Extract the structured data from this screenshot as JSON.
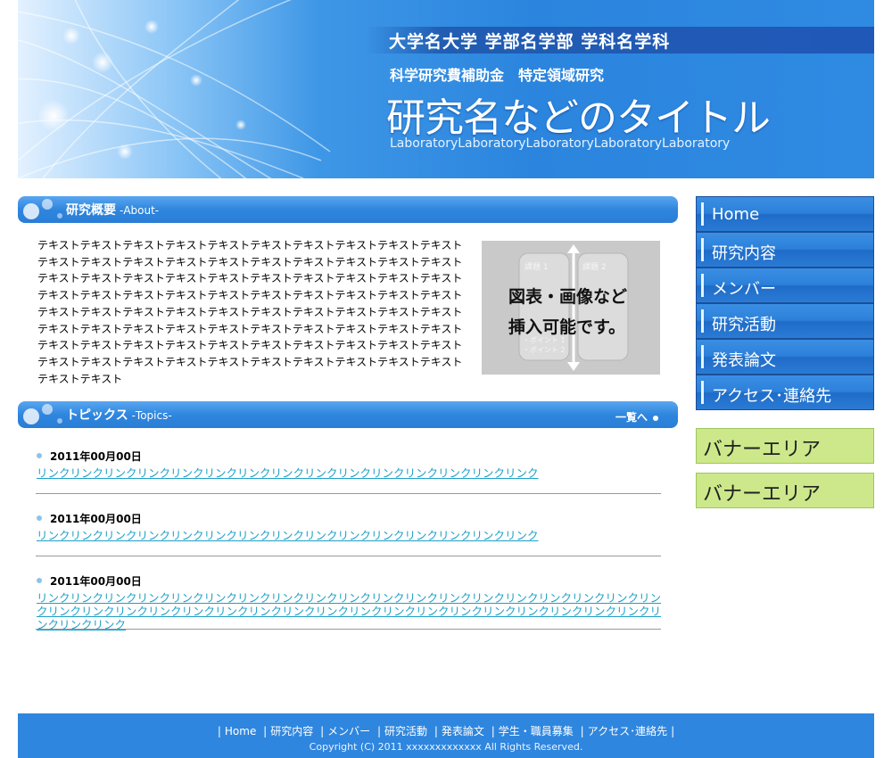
{
  "header": {
    "university_line": "大学名大学 学部名学部 学科名学科",
    "grant_line": "科学研究費補助金　特定領域研究",
    "title": "研究名などのタイトル",
    "lab_line": "LaboratoryLaboratoryLaboratoryLaboratoryLaboratory"
  },
  "about": {
    "heading": "研究概要",
    "heading_en": "-About-",
    "text": "テキストテキストテキストテキストテキストテキストテキストテキストテキストテキストテキストテキストテキストテキストテキストテキストテキストテキストテキストテキストテキストテキストテキストテキストテキストテキストテキストテキストテキストテキストテキストテキストテキストテキストテキストテキストテキストテキストテキストテキストテキストテキストテキストテキストテキストテキストテキストテキストテキストテキストテキストテキストテキストテキストテキストテキストテキストテキストテキストテキストテキストテキストテキストテキストテキストテキストテキストテキストテキストテキストテキストテキストテキストテキストテキストテキストテキストテキストテキストテキストテキストテキスト",
    "image_text_1": "図表・画像など",
    "image_text_2": "挿入可能です。",
    "image_box_1": "課題 1",
    "image_box_2": "課題 2",
    "image_point_1": "・ポイント 1",
    "image_point_2": "・ポイント 2"
  },
  "topics": {
    "heading": "トピックス",
    "heading_en": "-Topics-",
    "more_label": "一覧へ",
    "items": [
      {
        "date": "2011年00月00日",
        "link": "リンクリンクリンクリンクリンクリンクリンクリンクリンクリンクリンクリンクリンクリンクリンク"
      },
      {
        "date": "2011年00月00日",
        "link": "リンクリンクリンクリンクリンクリンクリンクリンクリンクリンクリンクリンクリンクリンクリンク"
      },
      {
        "date": "2011年00月00日",
        "link": "リンクリンクリンクリンクリンクリンクリンクリンクリンクリンクリンクリンクリンクリンクリンクリンクリンクリンクリンクリンクリンクリンクリンクリンクリンクリンクリンクリンクリンクリンクリンクリンクリンクリンクリンクリンクリンクリンクリンクリンク"
      }
    ]
  },
  "nav": {
    "items": [
      "Home",
      "研究内容",
      "メンバー",
      "研究活動",
      "発表論文",
      "アクセス･連絡先"
    ]
  },
  "banners": [
    "バナーエリア",
    "バナーエリア"
  ],
  "footer": {
    "links": [
      "Home",
      "研究内容",
      "メンバー",
      "研究活動",
      "発表論文",
      "学生・職員募集",
      "アクセス･連絡先"
    ],
    "copyright": "Copyright (C) 2011 xxxxxxxxxxxxx All Rights Reserved."
  },
  "colors": {
    "primary_blue": "#2f86de",
    "banner_green": "#cce88a",
    "link": "#1e9fc8"
  }
}
